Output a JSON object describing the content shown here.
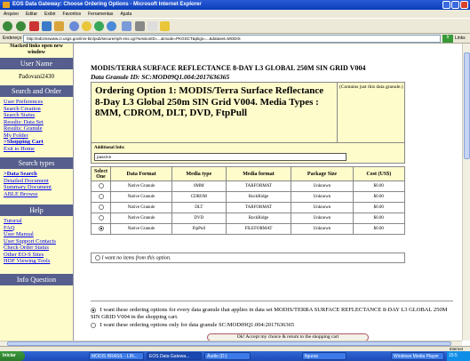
{
  "window": {
    "title": "EOS Data Gateway: Choose Ordering Options - Microsoft Internet Explorer"
  },
  "menu": [
    "Arquivo",
    "Editar",
    "Exibir",
    "Favoritos",
    "Ferramentas",
    "Ajuda"
  ],
  "address": {
    "label": "Endereço",
    "url": "http://edcimswww.cr.usgs.gov/ims-bin/pub/secure/nph-ims.cgi?sessionID=...&mode=PKGSCT&pkgs=...&dataset=MODIS",
    "go": "Ir",
    "links": "Links"
  },
  "sidebar": {
    "note": "Stacked links open new window",
    "user_header": "User Name",
    "user_name": "Padovani2430",
    "search_header": "Search and Order",
    "search_links": [
      "User Preferences",
      "Search Creation",
      "Search Status",
      "Results: Data Set",
      "Results: Granule",
      "My Folder",
      "Shopping Cart",
      "Exit to Home"
    ],
    "types_header": "Search types",
    "types_links": [
      "Data Search",
      "Detailed Document",
      "Summary Document",
      "ABLE Browse"
    ],
    "help_header": "Help",
    "help_links": [
      "Tutorial",
      "FAQ",
      "User Manual",
      "User Support Contacts",
      "Check Order Status",
      "Other EO-S Sites",
      "HDF Viewing Tools"
    ],
    "bottom_header": "Info Question"
  },
  "main": {
    "title": "MODIS/TERRA SURFACE REFLECTANCE 8-DAY L3 GLOBAL 250M SIN GRID V004",
    "granule": "Data Granule ID: SC:MOD09Q1.004:2017636365",
    "option_text": "Ordering Option 1: MODIS/Terra Surface Reflectance 8-Day L3 Global 250m SIN Grid V004. Media Types : 8MM, CDROM, DLT, DVD, FtpPull",
    "contains_note": "(Contains just this data granule.)",
    "additional_label": "Additional Info:",
    "additional_value": "passive",
    "table_headers": [
      "Select One",
      "Data Format",
      "Media type",
      "Media format",
      "Package Size",
      "Cost (US$)"
    ],
    "rows": [
      [
        "Native Granule",
        "8MM",
        "TARFORMAT",
        "Unknown",
        "$0.00"
      ],
      [
        "Native Granule",
        "CDROM",
        "RockRidge",
        "Unknown",
        "$0.00"
      ],
      [
        "Native Granule",
        "DLT",
        "TARFORMAT",
        "Unknown",
        "$0.00"
      ],
      [
        "Native Granule",
        "DVD",
        "RockRidge",
        "Unknown",
        "$0.00"
      ],
      [
        "Native Granule",
        "FtpPull",
        "FILEFORMAT",
        "Unknown",
        "$0.00"
      ]
    ],
    "selected_row": 4,
    "none_option": "I want no items from this option.",
    "apply_all": "I want these ordering options for every data granule that applies in data set MODIS/TERRA SURFACE REFLECTANCE 8-DAY L3 GLOBAL 250M SIN GRID V004 in the shopping cart.",
    "apply_one": "I want these ordering options only for data granule SC:MOD09Q1.004:2017636365",
    "ok_button": "Ok! Accept my choice & return to the shopping cart"
  },
  "status": {
    "zone": "Internet"
  },
  "taskbar": {
    "start": "Iniciar",
    "tasks": [
      "MODIS BRASIL - LIN...",
      "EOS Data Gatewa...",
      "Áudio (D:)",
      "figuras",
      "Windows Media Player"
    ],
    "clock": "15:5"
  }
}
